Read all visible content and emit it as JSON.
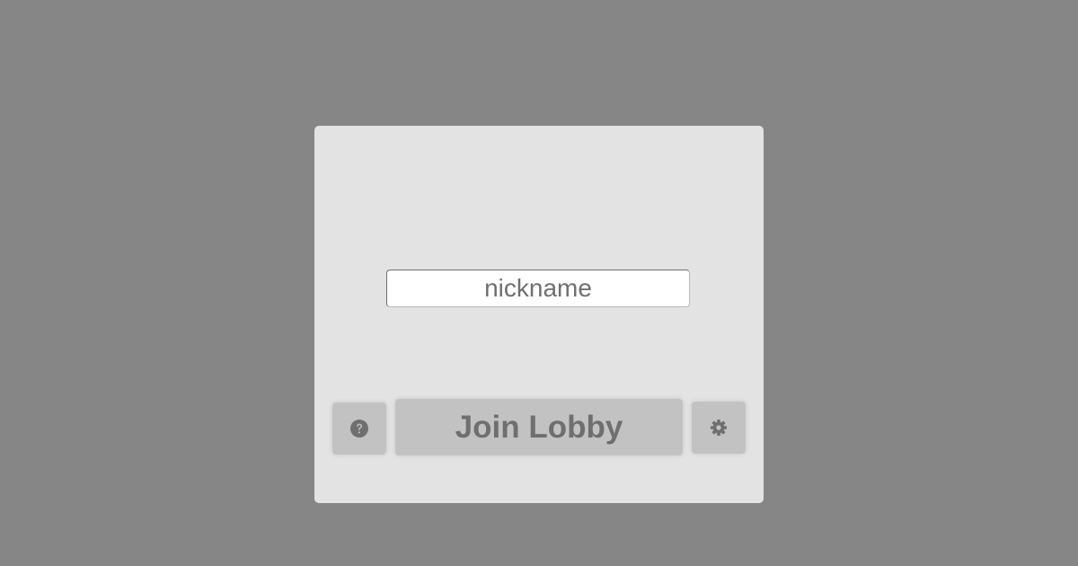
{
  "form": {
    "nickname_placeholder": "nickname",
    "nickname_value": "",
    "join_label": "Join Lobby"
  },
  "icons": {
    "help": "question-circle-icon",
    "settings": "gear-icon"
  },
  "colors": {
    "background": "#868686",
    "card": "#e3e3e3",
    "button": "#c2c2c2",
    "text": "#6f6f6f"
  }
}
